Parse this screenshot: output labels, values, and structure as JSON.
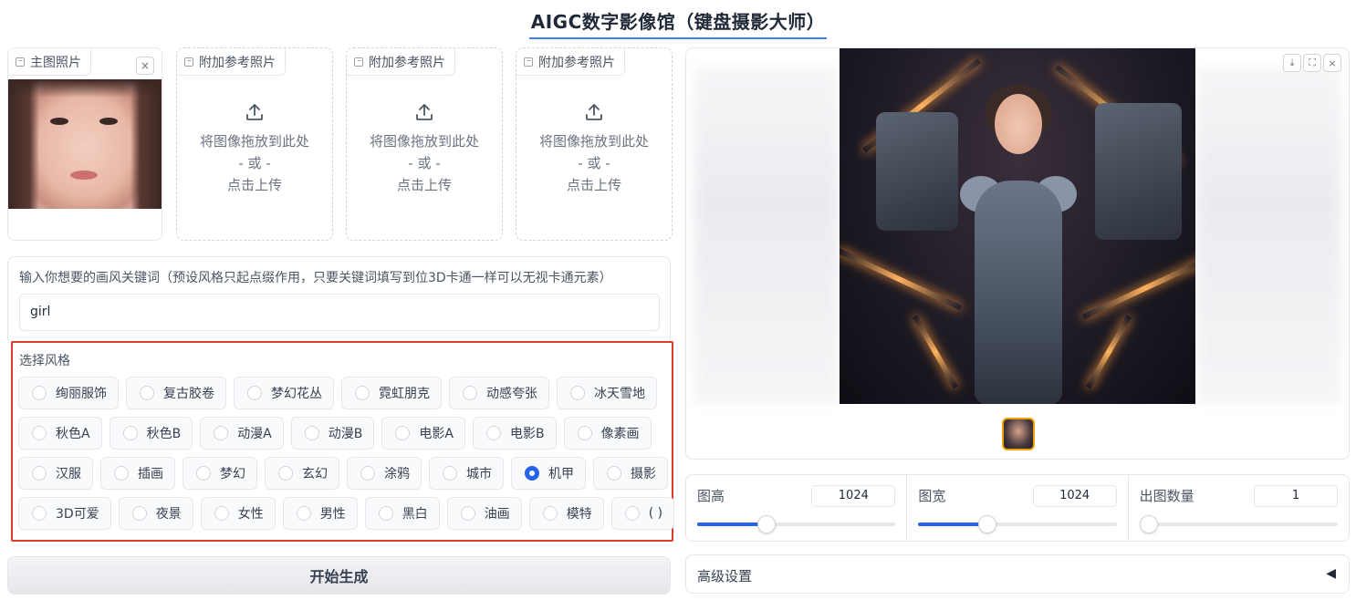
{
  "title": "AIGC数字影像馆（键盘摄影大师）",
  "upload": {
    "main_label": "主图照片",
    "ref_label": "附加参考照片",
    "drop_text": "将图像拖放到此处",
    "or_text": "- 或 -",
    "click_text": "点击上传",
    "close_icon": "×"
  },
  "prompt": {
    "label": "输入你想要的画风关键词（预设风格只起点缀作用，只要关键词填写到位3D卡通一样可以无视卡通元素）",
    "value": "girl"
  },
  "styles": {
    "label": "选择风格",
    "selected": "机甲",
    "rows": [
      [
        "绚丽服饰",
        "复古胶卷",
        "梦幻花丛",
        "霓虹朋克",
        "动感夸张",
        "冰天雪地"
      ],
      [
        "秋色A",
        "秋色B",
        "动漫A",
        "动漫B",
        "电影A",
        "电影B",
        "像素画"
      ],
      [
        "汉服",
        "插画",
        "梦幻",
        "玄幻",
        "涂鸦",
        "城市",
        "机甲",
        "摄影"
      ],
      [
        "3D可爱",
        "夜景",
        "女性",
        "男性",
        "黑白",
        "油画",
        "模特",
        "( )"
      ]
    ]
  },
  "generate_label": "开始生成",
  "gallery": {
    "download_icon": "⤓",
    "fullscreen_icon": "⛶",
    "close_icon": "×"
  },
  "sliders": [
    {
      "label": "图高",
      "value": "1024",
      "fraction": 0.35
    },
    {
      "label": "图宽",
      "value": "1024",
      "fraction": 0.35
    },
    {
      "label": "出图数量",
      "value": "1",
      "fraction": 0.0
    }
  ],
  "advanced": {
    "label": "高级设置",
    "arrow": "◀"
  },
  "colors": {
    "accent": "#2563eb",
    "highlight_border": "#e03b2f",
    "title_underline": "#3b82f6"
  }
}
